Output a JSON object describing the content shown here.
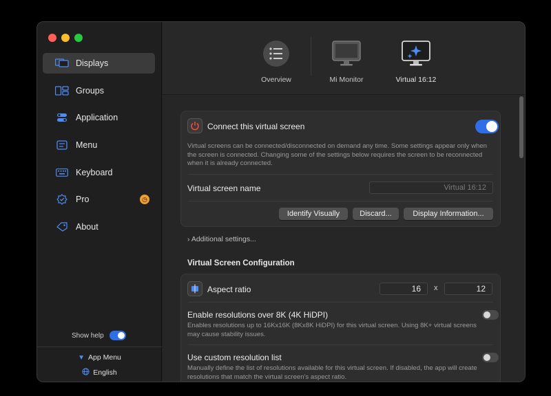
{
  "sidebar": {
    "items": [
      {
        "label": "Displays",
        "icon": "displays-icon",
        "active": true
      },
      {
        "label": "Groups",
        "icon": "groups-icon"
      },
      {
        "label": "Application",
        "icon": "application-icon"
      },
      {
        "label": "Menu",
        "icon": "menu-icon"
      },
      {
        "label": "Keyboard",
        "icon": "keyboard-icon"
      },
      {
        "label": "Pro",
        "icon": "pro-icon"
      },
      {
        "label": "About",
        "icon": "about-icon"
      }
    ],
    "show_help_label": "Show help",
    "app_menu_label": "App Menu",
    "language_label": "English"
  },
  "toolbar": {
    "overview_label": "Overview",
    "mi_monitor_label": "Mi Monitor",
    "virtual_label": "Virtual 16:12"
  },
  "connect_card": {
    "title": "Connect this virtual screen",
    "description": "Virtual screens can be connected/disconnected on demand any time. Some settings appear only when the screen is connected. Changing some of the settings below requires the screen to be reconnected when it is already connected.",
    "name_label": "Virtual screen name",
    "name_placeholder": "Virtual 16:12",
    "identify_button": "Identify Visually",
    "discard_button": "Discard...",
    "info_button": "Display Information..."
  },
  "additional_settings": "Additional settings...",
  "config": {
    "heading": "Virtual Screen Configuration",
    "aspect_label": "Aspect ratio",
    "aspect_w": "16",
    "aspect_sep": "x",
    "aspect_h": "12",
    "over8k_title": "Enable resolutions over 8K (4K HiDPI)",
    "over8k_desc": "Enables resolutions up to 16Kx16K (8Kx8K HiDPI) for this virtual screen. Using 8K+ virtual screens may cause stability issues.",
    "custom_title": "Use custom resolution list",
    "custom_desc": "Manually define the list of resolutions available for this virtual screen. If disabled, the app will create resolutions that match the virtual screen's aspect ratio."
  },
  "colors": {
    "accent": "#2f6ee6",
    "pro_badge": "#f0a030"
  }
}
